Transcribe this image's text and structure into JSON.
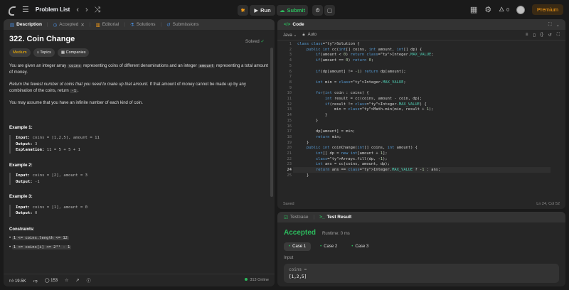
{
  "topbar": {
    "problem_list": "Problem List",
    "run": "Run",
    "submit": "Submit",
    "streak": "0",
    "premium": "Premium"
  },
  "left_tabs": [
    "Description",
    "Accepted",
    "Editorial",
    "Solutions",
    "Submissions"
  ],
  "problem": {
    "title": "322. Coin Change",
    "status": "Solved",
    "difficulty": "Medium",
    "tag_topics": "Topics",
    "tag_companies": "Companies",
    "p1a": "You are given an integer array ",
    "p1b": "coins",
    "p1c": " representing coins of different denominations and an integer ",
    "p1d": "amount",
    "p1e": " representing a total amount of money.",
    "p2a": "Return the fewest number of coins that you need to make up that amount.",
    "p2b": " If that amount of money cannot be made up by any combination of the coins, return ",
    "p2c": "-1",
    "p2d": ".",
    "p3": "You may assume that you have an infinite number of each kind of coin.",
    "examples": [
      {
        "h": "Example 1:",
        "input": "coins = [1,2,5], amount = 11",
        "output": "3",
        "explanation": "11 = 5 + 5 + 1"
      },
      {
        "h": "Example 2:",
        "input": "coins = [2], amount = 3",
        "output": "-1"
      },
      {
        "h": "Example 3:",
        "input": "coins = [1], amount = 0",
        "output": "0"
      }
    ],
    "labels": {
      "input": "Input:",
      "output": "Output:",
      "explanation": "Explanation:"
    },
    "constraints_h": "Constraints:",
    "c1": "1 <= coins.length <= 12",
    "c2": "1 <= coins[i] <= 2³¹ - 1"
  },
  "footer": {
    "likes": "19.5K",
    "comments": "153",
    "online": "313 Online"
  },
  "code_panel": {
    "title": "Code",
    "language": "Java",
    "mode": "Auto",
    "saved": "Saved",
    "cursor": "Ln 24, Col 52"
  },
  "code_lines": [
    "class Solution {",
    "    public int cc(int[] coins, int amount, int[] dp) {",
    "        if(amount < 0) return Integer.MAX_VALUE;",
    "        if(amount == 0) return 0;",
    "",
    "        if(dp[amount] != -1) return dp[amount];",
    "",
    "        int min = Integer.MAX_VALUE;",
    "",
    "        for(int coin : coins) {",
    "            int result = cc(coins, amount - coin, dp);",
    "            if(result != Integer.MAX_VALUE) {",
    "                min = Math.min(min, result + 1);",
    "            }",
    "        }",
    "",
    "        dp[amount] = min;",
    "        return min;",
    "    }",
    "    public int coinChange(int[] coins, int amount) {",
    "        int[] dp = new int[amount + 1];",
    "        Arrays.fill(dp, -1);",
    "        int ans = cc(coins, amount, dp);",
    "        return ans == Integer.MAX_VALUE ? -1 : ans;",
    "    }"
  ],
  "result_panel": {
    "tab_testcase": "Testcase",
    "tab_result": "Test Result",
    "status": "Accepted",
    "runtime": "Runtime: 0 ms",
    "cases": [
      "Case 1",
      "Case 2",
      "Case 3"
    ],
    "input_label": "Input",
    "var_name": "coins =",
    "var_value": "[1,2,5]"
  },
  "colors": {
    "accent_green": "#2cbb5d",
    "medium": "#ffb800",
    "premium": "#ffa116"
  }
}
